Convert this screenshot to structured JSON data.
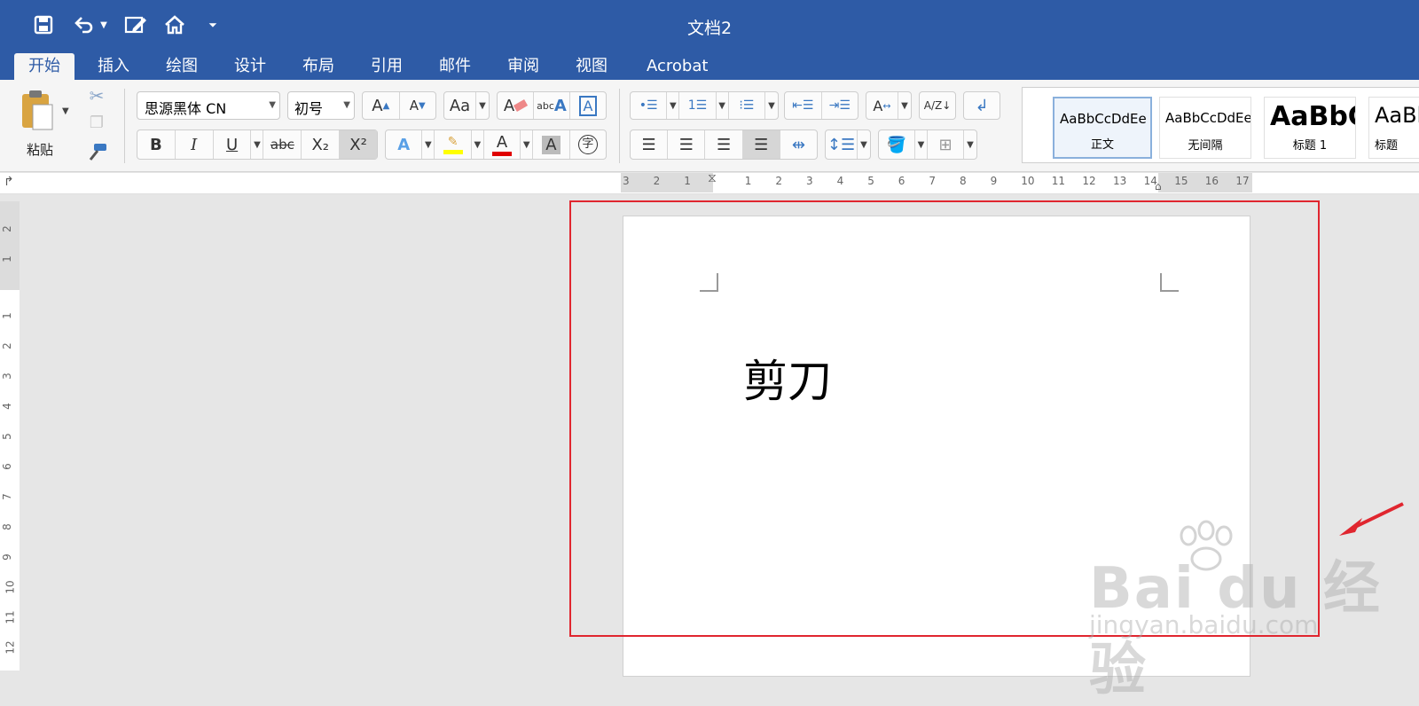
{
  "window": {
    "title": "文档2"
  },
  "tabs": [
    {
      "label": "开始",
      "active": true
    },
    {
      "label": "插入"
    },
    {
      "label": "绘图"
    },
    {
      "label": "设计"
    },
    {
      "label": "布局"
    },
    {
      "label": "引用"
    },
    {
      "label": "邮件"
    },
    {
      "label": "审阅"
    },
    {
      "label": "视图"
    },
    {
      "label": "Acrobat"
    }
  ],
  "clipboard": {
    "paste_label": "粘贴"
  },
  "font": {
    "name": "思源黑体 CN",
    "size": "初号",
    "bold": "B",
    "italic": "I",
    "underline": "U",
    "strike": "abc",
    "subscript": "X₂",
    "superscript": "X²",
    "clear_format": "abc",
    "phonetic": "字"
  },
  "styles": [
    {
      "sample": "AaBbCcDdEe",
      "name": "正文",
      "selected": true
    },
    {
      "sample": "AaBbCcDdEe",
      "name": "无间隔"
    },
    {
      "sample": "AaBbC",
      "name": "标题 1"
    },
    {
      "sample": "AaBb",
      "name": "标题"
    }
  ],
  "ruler": {
    "h_ticks": [
      "3",
      "2",
      "1",
      "1",
      "2",
      "3",
      "4",
      "5",
      "6",
      "7",
      "8",
      "9",
      "10",
      "11",
      "12",
      "13",
      "14",
      "15",
      "16",
      "17"
    ],
    "v_ticks": [
      "2",
      "1",
      "1",
      "2",
      "3",
      "4",
      "5",
      "6",
      "7",
      "8",
      "9",
      "10",
      "11",
      "12"
    ]
  },
  "document": {
    "text": "剪刀"
  },
  "watermark": {
    "logo": "Bai du 经验",
    "url": "jingyan.baidu.com"
  },
  "colors": {
    "accent": "#2e5ba6",
    "highlight": "#ffff00",
    "font_color": "#e00000",
    "annotation": "#e0262f"
  }
}
